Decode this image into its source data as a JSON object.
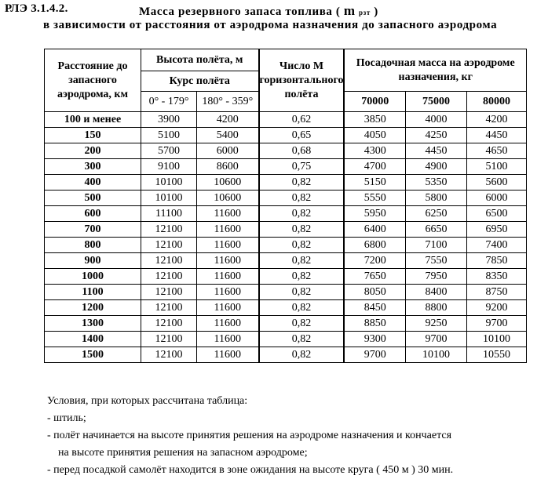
{
  "header": {
    "ref": "РЛЭ  3.1.4.2.",
    "title_pre": "Масса  резервного  запаса  топлива  (",
    "title_symbol": "m",
    "title_subscript": "рзт",
    "title_post": ")",
    "subtitle": "в  зависимости  от  расстояния  от  аэродрома  назначения  до  запасного  аэродрома"
  },
  "table": {
    "col_distance": "Расстояние до запасного аэродрома, км",
    "col_altitude": "Высота полёта,  м",
    "col_course": "Курс  полёта",
    "course_a": "0° - 179°",
    "course_b": "180° - 359°",
    "col_mach": "Число M горизонтального полёта",
    "col_mass": "Посадочная масса  на аэродроме назначения,  кг",
    "mass_a": "70000",
    "mass_b": "75000",
    "mass_c": "80000",
    "rows": [
      {
        "dist": "100 и менее",
        "h1": "3900",
        "h2": "4200",
        "m": "0,62",
        "a": "3850",
        "b": "4000",
        "c": "4200"
      },
      {
        "dist": "150",
        "h1": "5100",
        "h2": "5400",
        "m": "0,65",
        "a": "4050",
        "b": "4250",
        "c": "4450"
      },
      {
        "dist": "200",
        "h1": "5700",
        "h2": "6000",
        "m": "0,68",
        "a": "4300",
        "b": "4450",
        "c": "4650"
      },
      {
        "dist": "300",
        "h1": "9100",
        "h2": "8600",
        "m": "0,75",
        "a": "4700",
        "b": "4900",
        "c": "5100"
      },
      {
        "dist": "400",
        "h1": "10100",
        "h2": "10600",
        "m": "0,82",
        "a": "5150",
        "b": "5350",
        "c": "5600"
      },
      {
        "dist": "500",
        "h1": "10100",
        "h2": "10600",
        "m": "0,82",
        "a": "5550",
        "b": "5800",
        "c": "6000"
      },
      {
        "dist": "600",
        "h1": "11100",
        "h2": "11600",
        "m": "0,82",
        "a": "5950",
        "b": "6250",
        "c": "6500"
      },
      {
        "dist": "700",
        "h1": "12100",
        "h2": "11600",
        "m": "0,82",
        "a": "6400",
        "b": "6650",
        "c": "6950"
      },
      {
        "dist": "800",
        "h1": "12100",
        "h2": "11600",
        "m": "0,82",
        "a": "6800",
        "b": "7100",
        "c": "7400"
      },
      {
        "dist": "900",
        "h1": "12100",
        "h2": "11600",
        "m": "0,82",
        "a": "7200",
        "b": "7550",
        "c": "7850"
      },
      {
        "dist": "1000",
        "h1": "12100",
        "h2": "11600",
        "m": "0,82",
        "a": "7650",
        "b": "7950",
        "c": "8350"
      },
      {
        "dist": "1100",
        "h1": "12100",
        "h2": "11600",
        "m": "0,82",
        "a": "8050",
        "b": "8400",
        "c": "8750"
      },
      {
        "dist": "1200",
        "h1": "12100",
        "h2": "11600",
        "m": "0,82",
        "a": "8450",
        "b": "8800",
        "c": "9200"
      },
      {
        "dist": "1300",
        "h1": "12100",
        "h2": "11600",
        "m": "0,82",
        "a": "8850",
        "b": "9250",
        "c": "9700"
      },
      {
        "dist": "1400",
        "h1": "12100",
        "h2": "11600",
        "m": "0,82",
        "a": "9300",
        "b": "9700",
        "c": "10100"
      },
      {
        "dist": "1500",
        "h1": "12100",
        "h2": "11600",
        "m": "0,82",
        "a": "9700",
        "b": "10100",
        "c": "10550"
      }
    ]
  },
  "notes": {
    "intro": "Условия, при которых рассчитана таблица:",
    "items": [
      " - штиль;",
      " - полёт начинается на высоте принятия решения на аэродроме назначения и кончается",
      "    на высоте принятия решения на запасном аэродроме;",
      " - перед посадкой самолёт находится в зоне ожидания на высоте круга ( 450 м )  30 мин."
    ]
  }
}
